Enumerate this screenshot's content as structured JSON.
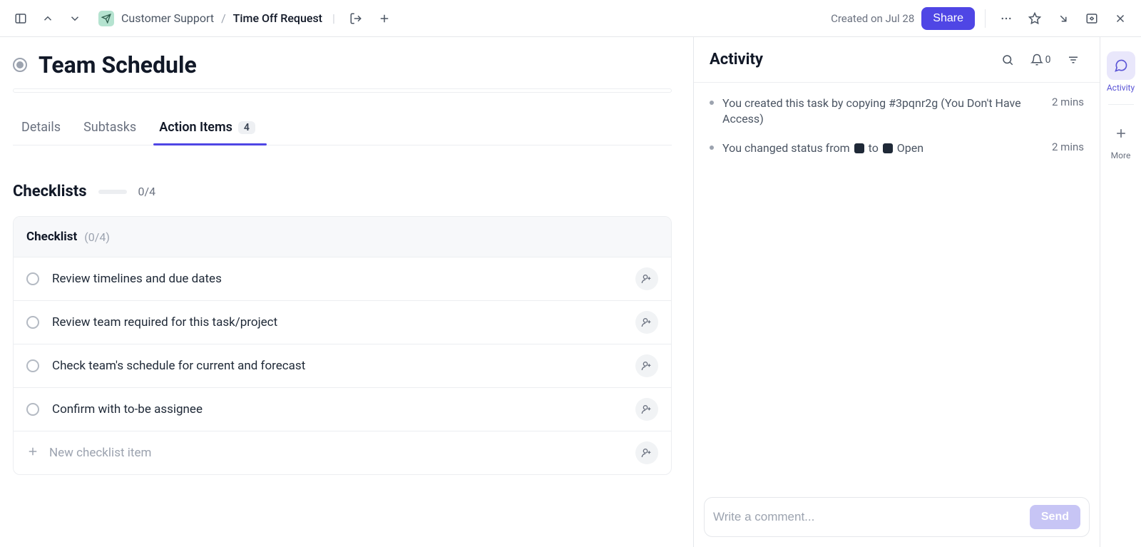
{
  "header": {
    "breadcrumb": {
      "spaceLabel": "Customer Support",
      "currentLabel": "Time Off Request"
    },
    "createdOn": "Created on Jul 28",
    "shareLabel": "Share"
  },
  "task": {
    "title": "Team Schedule"
  },
  "tabs": {
    "detailsLabel": "Details",
    "subtasksLabel": "Subtasks",
    "actionItemsLabel": "Action Items",
    "actionItemsBadge": "4"
  },
  "checklists": {
    "sectionTitle": "Checklists",
    "totalCount": "0/4",
    "group": {
      "name": "Checklist",
      "count": "(0/4)",
      "items": [
        "Review timelines and due dates",
        "Review team required for this task/project",
        "Check team's schedule for current and forecast",
        "Confirm with to-be assignee"
      ],
      "newItemPlaceholder": "New checklist item"
    }
  },
  "activity": {
    "title": "Activity",
    "notifCount": "0",
    "entries": [
      {
        "text_pre": "You created this task by copying #3pqnr2g (You Don't Have Access)",
        "time": "2 mins",
        "type": "plain"
      },
      {
        "text_pre": "You changed status from ",
        "text_mid": " to ",
        "text_post": " Open",
        "time": "2 mins",
        "type": "swatches"
      }
    ],
    "commentPlaceholder": "Write a comment...",
    "sendLabel": "Send"
  },
  "rail": {
    "activityLabel": "Activity",
    "moreLabel": "More"
  }
}
